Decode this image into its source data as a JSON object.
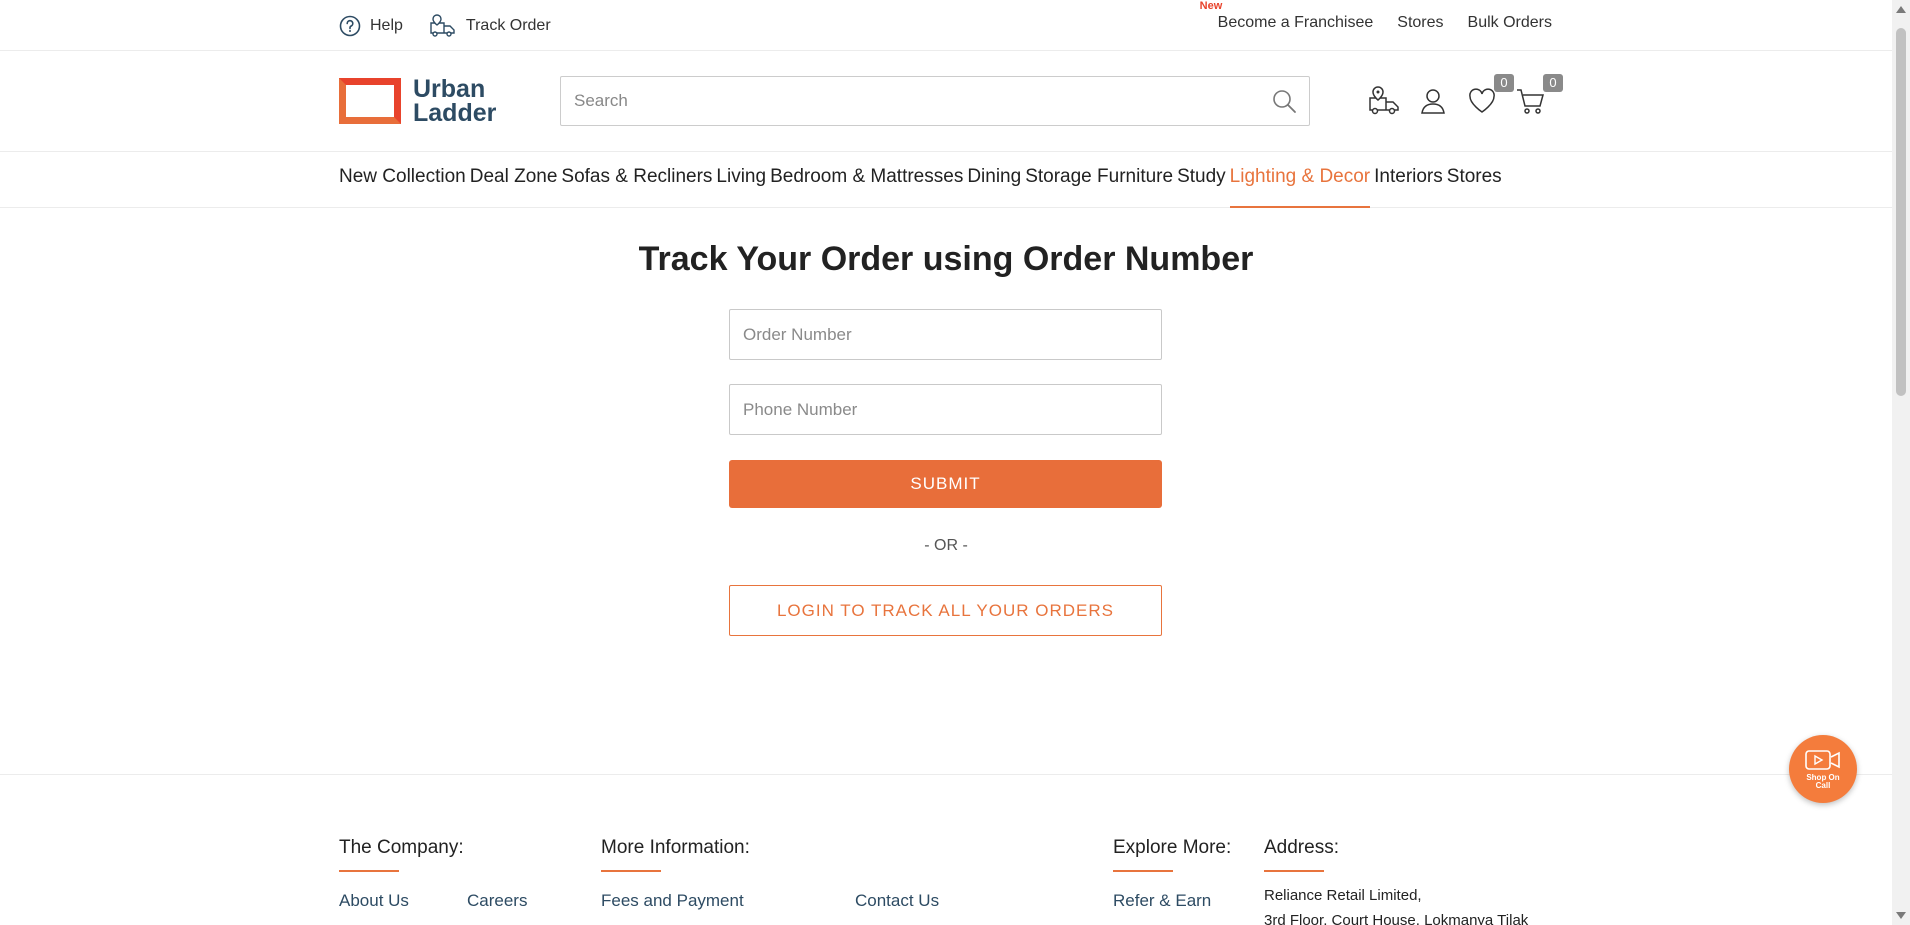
{
  "topbar": {
    "help": "Help",
    "track_order": "Track Order",
    "new_badge": "New",
    "franchisee": "Become a Franchisee",
    "stores": "Stores",
    "bulk_orders": "Bulk Orders"
  },
  "header": {
    "logo_line1": "Urban",
    "logo_line2": "Ladder",
    "search_placeholder": "Search",
    "wishlist_count": "0",
    "cart_count": "0"
  },
  "nav": {
    "items": [
      {
        "label": "New Collection"
      },
      {
        "label": "Deal Zone"
      },
      {
        "label": "Sofas & Recliners"
      },
      {
        "label": "Living"
      },
      {
        "label": "Bedroom & Mattresses"
      },
      {
        "label": "Dining"
      },
      {
        "label": "Storage Furniture"
      },
      {
        "label": "Study"
      },
      {
        "label": "Lighting & Decor"
      },
      {
        "label": "Interiors"
      },
      {
        "label": "Stores"
      }
    ],
    "active_index": 8
  },
  "main": {
    "title": "Track Your Order using Order Number",
    "order_placeholder": "Order Number",
    "phone_placeholder": "Phone Number",
    "submit_label": "SUBMIT",
    "or_text": "- OR -",
    "login_label": "LOGIN TO TRACK ALL YOUR ORDERS"
  },
  "footer": {
    "company_heading": "The Company:",
    "about_us": "About Us",
    "careers": "Careers",
    "more_info_heading": "More Information:",
    "fees_payment": "Fees and Payment",
    "contact_us": "Contact Us",
    "explore_heading": "Explore More:",
    "refer_earn": "Refer & Earn",
    "address_heading": "Address:",
    "address_line1": "Reliance Retail Limited,",
    "address_line2": "3rd Floor, Court House, Lokmanya Tilak"
  },
  "floating": {
    "shop_on_call": "Shop On Call"
  },
  "colors": {
    "accent": "#e86e3a",
    "brand_text": "#2d4b63"
  }
}
